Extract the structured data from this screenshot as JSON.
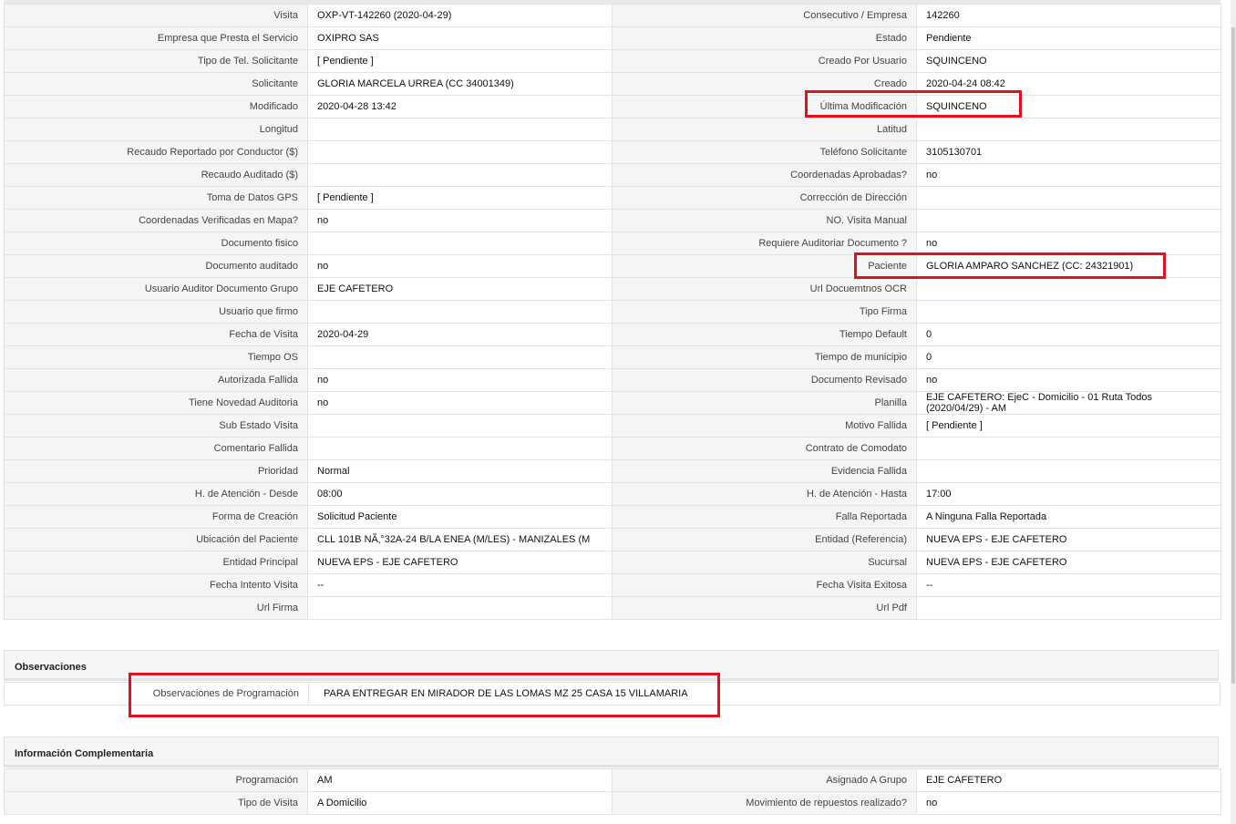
{
  "details": {
    "rows": [
      {
        "l1": "Visita",
        "v1": "OXP-VT-142260 (2020-04-29)",
        "l2": "Consecutivo / Empresa",
        "v2": "142260"
      },
      {
        "l1": "Empresa que Presta el Servicio",
        "v1": "OXIPRO SAS",
        "l2": "Estado",
        "v2": "Pendiente"
      },
      {
        "l1": "Tipo de Tel. Solicitante",
        "v1": "[ Pendiente ]",
        "l2": "Creado Por Usuario",
        "v2": "SQUINCENO"
      },
      {
        "l1": "Solicitante",
        "v1": "GLORIA MARCELA URREA (CC 34001349)",
        "l2": "Creado",
        "v2": "2020-04-24 08:42"
      },
      {
        "l1": "Modificado",
        "v1": "2020-04-28 13:42",
        "l2": "Última Modificación",
        "v2": "SQUINCENO"
      },
      {
        "l1": "Longitud",
        "v1": "",
        "l2": "Latitud",
        "v2": ""
      },
      {
        "l1": "Recaudo Reportado por Conductor ($)",
        "v1": "",
        "l2": "Teléfono Solicitante",
        "v2": "3105130701"
      },
      {
        "l1": "Recaudo Auditado ($)",
        "v1": "",
        "l2": "Coordenadas Aprobadas?",
        "v2": "no"
      },
      {
        "l1": "Toma de Datos GPS",
        "v1": "[ Pendiente ]",
        "l2": "Corrección de Dirección",
        "v2": ""
      },
      {
        "l1": "Coordenadas Verificadas en Mapa?",
        "v1": "no",
        "l2": "NO. Visita Manual",
        "v2": ""
      },
      {
        "l1": "Documento fisico",
        "v1": "",
        "l2": "Requiere Auditoriar Documento ?",
        "v2": "no"
      },
      {
        "l1": "Documento auditado",
        "v1": "no",
        "l2": "Paciente",
        "v2": "GLORIA AMPARO SANCHEZ (CC: 24321901)"
      },
      {
        "l1": "Usuario Auditor Documento Grupo",
        "v1": "EJE CAFETERO",
        "l2": "Url Docuemtnos OCR",
        "v2": ""
      },
      {
        "l1": "Usuario que firmo",
        "v1": "",
        "l2": "Tipo Firma",
        "v2": ""
      },
      {
        "l1": "Fecha de Visita",
        "v1": "2020-04-29",
        "l2": "Tiempo Default",
        "v2": "0"
      },
      {
        "l1": "Tiempo OS",
        "v1": "",
        "l2": "Tiempo de municipio",
        "v2": "0"
      },
      {
        "l1": "Autorizada Fallida",
        "v1": "no",
        "l2": "Documento Revisado",
        "v2": "no"
      },
      {
        "l1": "Tiene Novedad Auditoria",
        "v1": "no",
        "l2": "Planilla",
        "v2": "EJE CAFETERO: EjeC - Domicilio - 01 Ruta Todos (2020/04/29) - AM"
      },
      {
        "l1": "Sub Estado Visita",
        "v1": "",
        "l2": "Motivo Fallida",
        "v2": "[ Pendiente ]"
      },
      {
        "l1": "Comentario Fallida",
        "v1": "",
        "l2": "Contrato de Comodato",
        "v2": ""
      },
      {
        "l1": "Prioridad",
        "v1": "Normal",
        "l2": "Evidencia Fallida",
        "v2": ""
      },
      {
        "l1": "H. de Atención - Desde",
        "v1": "08:00",
        "l2": "H. de Atención - Hasta",
        "v2": "17:00"
      },
      {
        "l1": "Forma de Creación",
        "v1": "Solicitud Paciente",
        "l2": "Falla Reportada",
        "v2": "A Ninguna Falla Reportada"
      },
      {
        "l1": "Ubicación del Paciente",
        "v1": "CLL 101B NÃ‚°32A-24 B/LA ENEA (M/LES) - MANIZALES (M",
        "l2": "Entidad (Referencia)",
        "v2": "NUEVA EPS - EJE CAFETERO"
      },
      {
        "l1": "Entidad Principal",
        "v1": "NUEVA EPS - EJE CAFETERO",
        "l2": "Sucursal",
        "v2": "NUEVA EPS - EJE CAFETERO"
      },
      {
        "l1": "Fecha Intento Visita",
        "v1": "--",
        "l2": "Fecha Visita Exitosa",
        "v2": "--"
      },
      {
        "l1": "Url Firma",
        "v1": "",
        "l2": "Url Pdf",
        "v2": ""
      }
    ]
  },
  "observaciones": {
    "title": "Observaciones",
    "label": "Observaciones de Programación",
    "value": "PARA ENTREGAR EN MIRADOR DE LAS LOMAS MZ 25 CASA 15 VILLAMARIA"
  },
  "complementaria": {
    "title": "Información Complementaria",
    "rows": [
      {
        "l1": "Programación",
        "v1": "AM",
        "l2": "Asignado A Grupo",
        "v2": "EJE CAFETERO"
      },
      {
        "l1": "Tipo de Visita",
        "v1": "A Domicilio",
        "l2": "Movimiento de repuestos realizado?",
        "v2": "no"
      }
    ]
  },
  "colors": {
    "highlight": "#e0111c",
    "label_bg": "#f5f5f5",
    "border": "#e3e3e3"
  }
}
